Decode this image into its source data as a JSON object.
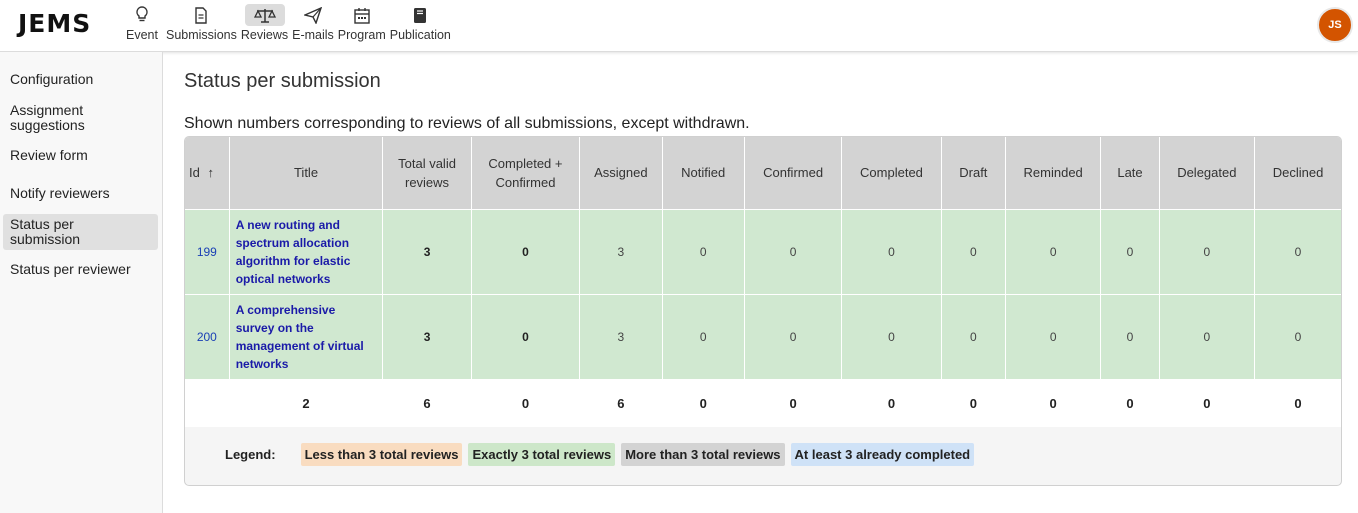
{
  "app": {
    "logo": "JEMS",
    "user_initials": "JS"
  },
  "nav": [
    {
      "label": "Event",
      "icon": "lightbulb-icon"
    },
    {
      "label": "Submissions",
      "icon": "document-icon"
    },
    {
      "label": "Reviews",
      "icon": "scale-icon",
      "active": true
    },
    {
      "label": "E-mails",
      "icon": "paper-plane-icon"
    },
    {
      "label": "Program",
      "icon": "calendar-icon"
    },
    {
      "label": "Publication",
      "icon": "book-icon"
    }
  ],
  "sidebar": {
    "items": [
      {
        "label": "Configuration"
      },
      {
        "label": "Assignment suggestions"
      },
      {
        "label": "Review form"
      },
      {
        "label": "Notify reviewers"
      },
      {
        "label": "Status per submission",
        "active": true
      },
      {
        "label": "Status per reviewer"
      }
    ]
  },
  "main": {
    "title": "Status per submission",
    "subtitle": "Shown numbers corresponding to reviews of all submissions, except withdrawn."
  },
  "table": {
    "columns": [
      "Id",
      "Title",
      "Total valid reviews",
      "Completed + Confirmed",
      "Assigned",
      "Notified",
      "Confirmed",
      "Completed",
      "Draft",
      "Reminded",
      "Late",
      "Delegated",
      "Declined"
    ],
    "sort_indicator": "↑",
    "rows": [
      {
        "id": "199",
        "title": "A new routing and spectrum allocation algorithm for elastic optical networks",
        "total_valid": "3",
        "completed_confirmed": "0",
        "assigned": "3",
        "notified": "0",
        "confirmed": "0",
        "completed": "0",
        "draft": "0",
        "reminded": "0",
        "late": "0",
        "delegated": "0",
        "declined": "0"
      },
      {
        "id": "200",
        "title": "A comprehensive survey on the management of virtual networks",
        "total_valid": "3",
        "completed_confirmed": "0",
        "assigned": "3",
        "notified": "0",
        "confirmed": "0",
        "completed": "0",
        "draft": "0",
        "reminded": "0",
        "late": "0",
        "delegated": "0",
        "declined": "0"
      }
    ],
    "totals": {
      "title": "2",
      "total_valid": "6",
      "completed_confirmed": "0",
      "assigned": "6",
      "notified": "0",
      "confirmed": "0",
      "completed": "0",
      "draft": "0",
      "reminded": "0",
      "late": "0",
      "delegated": "0",
      "declined": "0"
    }
  },
  "legend": {
    "label": "Legend:",
    "items": [
      {
        "text": "Less than 3 total reviews",
        "color": "#f9dcc0"
      },
      {
        "text": "Exactly 3 total reviews",
        "color": "#cde7c9"
      },
      {
        "text": "More than 3 total reviews",
        "color": "#d3d3d3"
      },
      {
        "text": "At least 3 already completed",
        "color": "#cfe2f7"
      }
    ]
  },
  "colors": {
    "row_green": "#d0e8d0",
    "header_gray": "#d3d3d3",
    "avatar": "#d35400",
    "link_blue": "#1a1aa8"
  }
}
